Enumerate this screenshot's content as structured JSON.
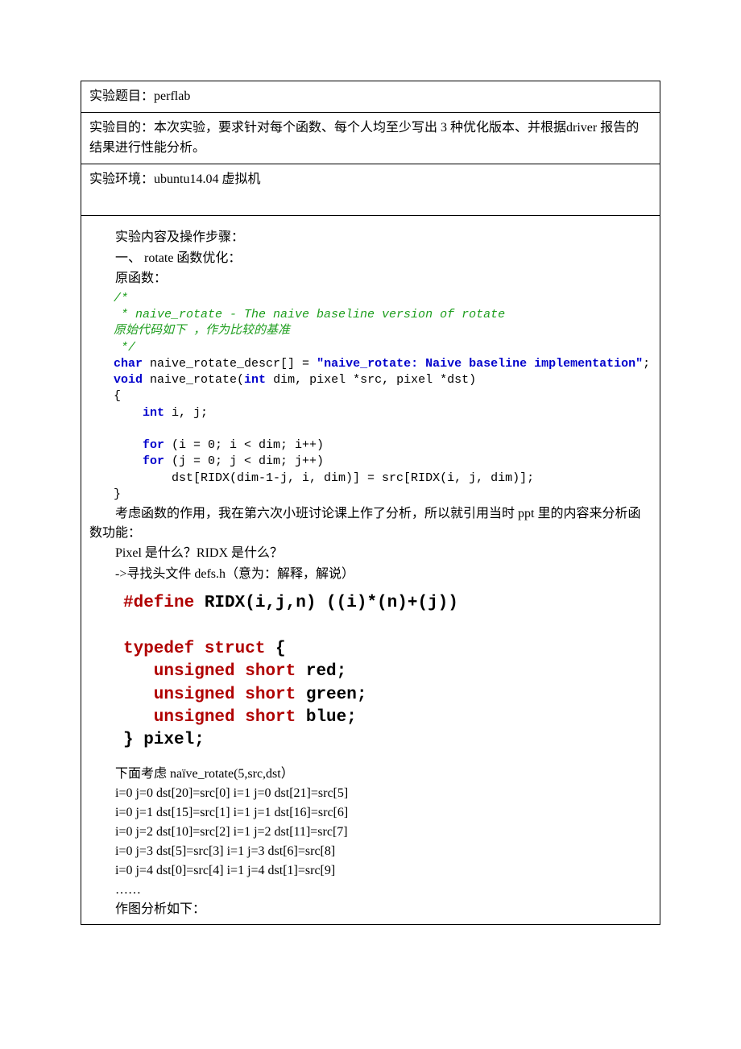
{
  "meta": {
    "title_label": "实验题目：",
    "title_value": "perflab",
    "purpose_label": "实验目的：",
    "purpose_value": "本次实验，要求针对每个函数、每个人均至少写出 3 种优化版本、并根据driver 报告的结果进行性能分析。",
    "env_label": "实验环境：",
    "env_value": "ubuntu14.04 虚拟机"
  },
  "body": {
    "steps_heading": "实验内容及操作步骤：",
    "section1_heading": "一、 rotate 函数优化：",
    "orig_func_label": "原函数：",
    "code1": {
      "c1": "/*",
      "c2": " * naive_rotate - The naive baseline version of rotate",
      "c3": "原始代码如下 ，作为比较的基准",
      "c4": " */",
      "l1a": "char",
      "l1b": " naive_rotate_descr[] = ",
      "l1c": "\"naive_rotate: Naive baseline implementation\"",
      "l1d": ";",
      "l2a": "void",
      "l2b": " naive_rotate(",
      "l2c": "int",
      "l2d": " dim, pixel *src, pixel *dst)",
      "l3": "{",
      "l4a": "    int",
      "l4b": " i, j;",
      "blank": "",
      "l5a": "    for",
      "l5b": " (i = 0; i < dim; i++)",
      "l6a": "    for",
      "l6b": " (j = 0; j < dim; j++)",
      "l7": "        dst[RIDX(dim-1-j, i, dim)] = src[RIDX(i, j, dim)];",
      "l8": "}"
    },
    "para_after_code1_a": "考虑函数的作用，我在第六次小班讨论课上作了分析，所以就引用当时 ppt 里的内容来分析函",
    "para_after_code1_b": "数功能：",
    "q_pixel": "Pixel 是什么？RIDX 是什么？",
    "seek_defs": "->寻找头文件 defs.h（意为：解释，解说）",
    "code2": {
      "l1a": "#define",
      "l1b": " RIDX(i,j,n) ((i)*(n)+(j))",
      "blank": "",
      "l2a": "typedef",
      "l2b": " ",
      "l2c": "struct",
      "l2d": " {",
      "l3a": "   unsigned",
      "l3b": " ",
      "l3c": "short",
      "l3d": " red;",
      "l4a": "   unsigned",
      "l4b": " ",
      "l4c": "short",
      "l4d": " green;",
      "l5a": "   unsigned",
      "l5b": " ",
      "l5c": "short",
      "l5d": " blue;",
      "l6": "} pixel;"
    },
    "consider_line": "下面考虑 naïve_rotate(5,src,dst）",
    "trace": [
      "i=0 j=0 dst[20]=src[0]     i=1   j=0 dst[21]=src[5]",
      "i=0 j=1    dst[15]=src[1] i=1   j=1 dst[16]=src[6]",
      "i=0 j=2   dst[10]=src[2]  i=1   j=2 dst[11]=src[7]",
      "i=0 j=3   dst[5]=src[3]    i=1   j=3 dst[6]=src[8]",
      "i=0 j=4   dst[0]=src[4]    i=1   j=4 dst[1]=src[9]"
    ],
    "ellipsis": "……",
    "plot_line": "作图分析如下："
  }
}
